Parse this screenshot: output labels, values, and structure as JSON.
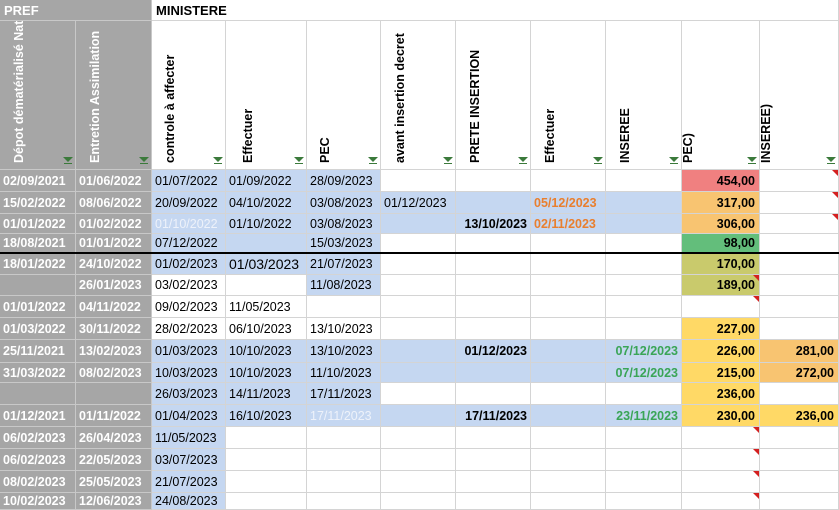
{
  "sections": {
    "pref": "PREF",
    "ministere": "MINISTERE"
  },
  "columns": [
    "Dépot dématérialisé Naturalisation",
    "Entretion Assimilation",
    "controle à affecter",
    "Effectuer",
    "PEC",
    "avant insertion decret",
    "PRETE INSERTION",
    "Effectuer",
    "INSEREE",
    "DELTA (AFFECTER - PEC)",
    "DELTA (AFFECTER - INSEREE)"
  ],
  "colors": {
    "blue": "#c5d7f1",
    "grey": "#a6a6a6",
    "red": "#f08080",
    "orange": "#f8c471",
    "green": "#63be7b",
    "olive": "#c9ca6c",
    "yellow": "#ffd966",
    "orange_text": "#e97f2e",
    "green_text": "#3aa557"
  },
  "rows": [
    {
      "cells": [
        "02/09/2021",
        "01/06/2022",
        "01/07/2022",
        "01/09/2022",
        "28/09/2023",
        "",
        "",
        "",
        "",
        "454,00",
        ""
      ],
      "bg": [
        null,
        null,
        "blue",
        "blue",
        "blue",
        null,
        null,
        null,
        null,
        "red",
        null
      ],
      "tri": [
        10
      ]
    },
    {
      "cells": [
        "15/02/2022",
        "08/06/2022",
        "20/09/2022",
        "04/10/2022",
        "03/08/2023",
        "01/12/2023",
        "",
        "05/12/2023",
        "",
        "317,00",
        ""
      ],
      "bg": [
        null,
        null,
        "blue",
        "blue",
        "blue",
        "blue",
        "blue",
        "blue",
        "blue",
        "orange",
        null
      ],
      "tri": [
        10
      ],
      "style": {
        "7": "orange"
      }
    },
    {
      "cells": [
        "01/01/2022",
        "01/02/2022",
        "01/10/2022",
        "01/10/2022",
        "03/08/2023",
        "",
        "13/10/2023",
        "02/11/2023",
        "",
        "306,00",
        ""
      ],
      "bg": [
        null,
        null,
        "blue",
        "blue",
        "blue",
        "blue",
        "blue",
        "blue",
        "blue",
        "orange",
        null
      ],
      "tri": [
        10
      ],
      "style": {
        "2": "faded",
        "6": "bold",
        "7": "orange"
      }
    },
    {
      "cells": [
        "18/08/2021",
        "01/01/2022",
        "07/12/2022",
        "",
        "15/03/2023",
        "",
        "",
        "",
        "",
        "98,00",
        ""
      ],
      "bg": [
        null,
        null,
        "blue",
        "blue",
        "blue",
        null,
        null,
        null,
        null,
        "green",
        null
      ],
      "tri": []
    },
    {
      "cells": [
        "18/01/2022",
        "24/10/2022",
        "01/02/2023",
        "01/03/2023",
        "21/07/2023",
        "",
        "",
        "",
        "",
        "170,00",
        ""
      ],
      "bg": [
        null,
        null,
        "blue",
        "blue",
        "blue",
        null,
        null,
        null,
        null,
        "olive",
        null
      ],
      "tri": [],
      "style": {
        "3": "big"
      }
    },
    {
      "cells": [
        "",
        "26/01/2023",
        "03/02/2023",
        "",
        "11/08/2023",
        "",
        "",
        "",
        "",
        "189,00",
        ""
      ],
      "bg": [
        null,
        null,
        null,
        null,
        "blue",
        null,
        null,
        null,
        null,
        "olive",
        null
      ],
      "tri": [
        9
      ]
    },
    {
      "cells": [
        "01/01/2022",
        "04/11/2022",
        "09/02/2023",
        "11/05/2023",
        "",
        "",
        "",
        "",
        "",
        "",
        ""
      ],
      "bg": [
        null,
        null,
        null,
        null,
        null,
        null,
        null,
        null,
        null,
        null,
        null
      ],
      "tri": [
        9
      ]
    },
    {
      "cells": [
        "01/03/2022",
        "30/11/2022",
        "28/02/2023",
        "06/10/2023",
        "13/10/2023",
        "",
        "",
        "",
        "",
        "227,00",
        ""
      ],
      "bg": [
        null,
        null,
        null,
        null,
        null,
        null,
        null,
        null,
        null,
        "yellow",
        null
      ],
      "tri": []
    },
    {
      "cells": [
        "25/11/2021",
        "13/02/2023",
        "01/03/2023",
        "10/10/2023",
        "13/10/2023",
        "",
        "01/12/2023",
        "",
        "07/12/2023",
        "226,00",
        "281,00"
      ],
      "bg": [
        null,
        null,
        "blue",
        "blue",
        "blue",
        "blue",
        "blue",
        "blue",
        "blue",
        "yellow",
        "orange"
      ],
      "tri": [],
      "style": {
        "6": "bold",
        "8": "green"
      }
    },
    {
      "cells": [
        "31/03/2022",
        "08/02/2023",
        "10/03/2023",
        "10/10/2023",
        "11/10/2023",
        "",
        "",
        "",
        "07/12/2023",
        "215,00",
        "272,00"
      ],
      "bg": [
        null,
        null,
        "blue",
        "blue",
        "blue",
        "blue",
        "blue",
        "blue",
        "blue",
        "yellow",
        "orange"
      ],
      "tri": [],
      "style": {
        "8": "green"
      }
    },
    {
      "cells": [
        "",
        "",
        "26/03/2023",
        "14/11/2023",
        "17/11/2023",
        "",
        "",
        "",
        "",
        "236,00",
        ""
      ],
      "bg": [
        null,
        null,
        "blue",
        "blue",
        "blue",
        null,
        null,
        null,
        null,
        "yellow",
        null
      ],
      "tri": []
    },
    {
      "cells": [
        "01/12/2021",
        "01/11/2022",
        "01/04/2023",
        "16/10/2023",
        "17/11/2023",
        "",
        "17/11/2023",
        "",
        "23/11/2023",
        "230,00",
        "236,00"
      ],
      "bg": [
        null,
        null,
        "blue",
        "blue",
        "blue",
        "blue",
        "blue",
        "blue",
        "blue",
        "yellow",
        "yellow"
      ],
      "tri": [],
      "style": {
        "4": "faded",
        "6": "bold",
        "8": "green"
      }
    },
    {
      "cells": [
        "06/02/2023",
        "26/04/2023",
        "11/05/2023",
        "",
        "",
        "",
        "",
        "",
        "",
        "",
        ""
      ],
      "bg": [
        null,
        null,
        "blue",
        null,
        null,
        null,
        null,
        null,
        null,
        null,
        null
      ],
      "tri": [
        9
      ]
    },
    {
      "cells": [
        "06/02/2023",
        "22/05/2023",
        "03/07/2023",
        "",
        "",
        "",
        "",
        "",
        "",
        "",
        ""
      ],
      "bg": [
        null,
        null,
        "blue",
        null,
        null,
        null,
        null,
        null,
        null,
        null,
        null
      ],
      "tri": [
        9
      ]
    },
    {
      "cells": [
        "08/02/2023",
        "25/05/2023",
        "21/07/2023",
        "",
        "",
        "",
        "",
        "",
        "",
        "",
        ""
      ],
      "bg": [
        null,
        null,
        "blue",
        null,
        null,
        null,
        null,
        null,
        null,
        null,
        null
      ],
      "tri": [
        9
      ]
    },
    {
      "cells": [
        "10/02/2023",
        "12/06/2023",
        "24/08/2023",
        "",
        "",
        "",
        "",
        "",
        "",
        "",
        ""
      ],
      "bg": [
        null,
        null,
        "blue",
        null,
        null,
        null,
        null,
        null,
        null,
        null,
        null
      ],
      "tri": [
        9
      ]
    }
  ]
}
